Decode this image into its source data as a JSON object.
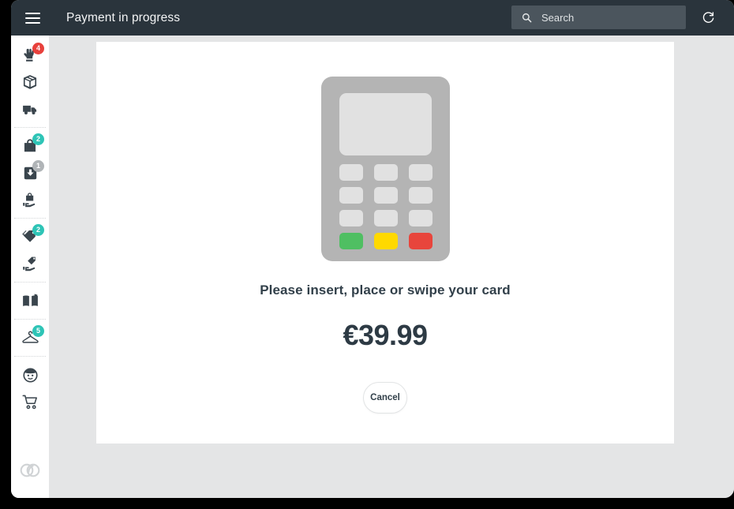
{
  "header": {
    "title": "Payment in progress",
    "menu_icon": "hamburger-icon",
    "search": {
      "placeholder": "Search",
      "value": "",
      "icon": "search-icon"
    },
    "refresh_icon": "refresh-icon",
    "background_color": "#2a343c"
  },
  "sidebar": {
    "background_color": "#ffffff",
    "brand_logo": "brand-logo-icon",
    "groups": [
      {
        "items": [
          {
            "icon": "hand-pointer-icon",
            "name": "sidebar-item-orders",
            "badge": "4",
            "badge_color": "#e8413c"
          },
          {
            "icon": "package-box-icon",
            "name": "sidebar-item-products",
            "badge": null,
            "badge_color": null
          },
          {
            "icon": "delivery-truck-icon",
            "name": "sidebar-item-shipping",
            "badge": null,
            "badge_color": null
          }
        ]
      },
      {
        "items": [
          {
            "icon": "shopping-bag-icon",
            "name": "sidebar-item-purchases",
            "badge": "2",
            "badge_color": "#2ec4b6"
          },
          {
            "icon": "inbox-download-icon",
            "name": "sidebar-item-receiving",
            "badge": "1",
            "badge_color": "#b0b4b7"
          },
          {
            "icon": "bag-hand-icon",
            "name": "sidebar-item-handover",
            "badge": null,
            "badge_color": null
          }
        ]
      },
      {
        "items": [
          {
            "icon": "price-tags-icon",
            "name": "sidebar-item-promotions",
            "badge": "2",
            "badge_color": "#2ec4b6"
          },
          {
            "icon": "tag-hand-icon",
            "name": "sidebar-item-pricing",
            "badge": null,
            "badge_color": null
          }
        ]
      },
      {
        "items": [
          {
            "icon": "open-book-icon",
            "name": "sidebar-item-catalog",
            "badge": null,
            "badge_color": null
          }
        ]
      },
      {
        "items": [
          {
            "icon": "clothes-hanger-icon",
            "name": "sidebar-item-apparel",
            "badge": "5",
            "badge_color": "#2ec4b6"
          }
        ]
      },
      {
        "items": [
          {
            "icon": "customer-face-icon",
            "name": "sidebar-item-customers",
            "badge": null,
            "badge_color": null
          },
          {
            "icon": "shopping-cart-icon",
            "name": "sidebar-item-cart",
            "badge": null,
            "badge_color": null
          }
        ]
      }
    ]
  },
  "payment": {
    "prompt": "Please insert, place or swipe your card",
    "amount": "€39.99",
    "cancel_label": "Cancel",
    "terminal": {
      "body_color": "#b4b4b4",
      "screen_color": "#e1e1e1",
      "key_color": "#e1e1e1",
      "green_key_color": "#4fbf62",
      "yellow_key_color": "#ffd900",
      "red_key_color": "#e8453c"
    }
  },
  "canvas": {
    "page_background": "#e4e5e6",
    "card_background": "#ffffff"
  }
}
